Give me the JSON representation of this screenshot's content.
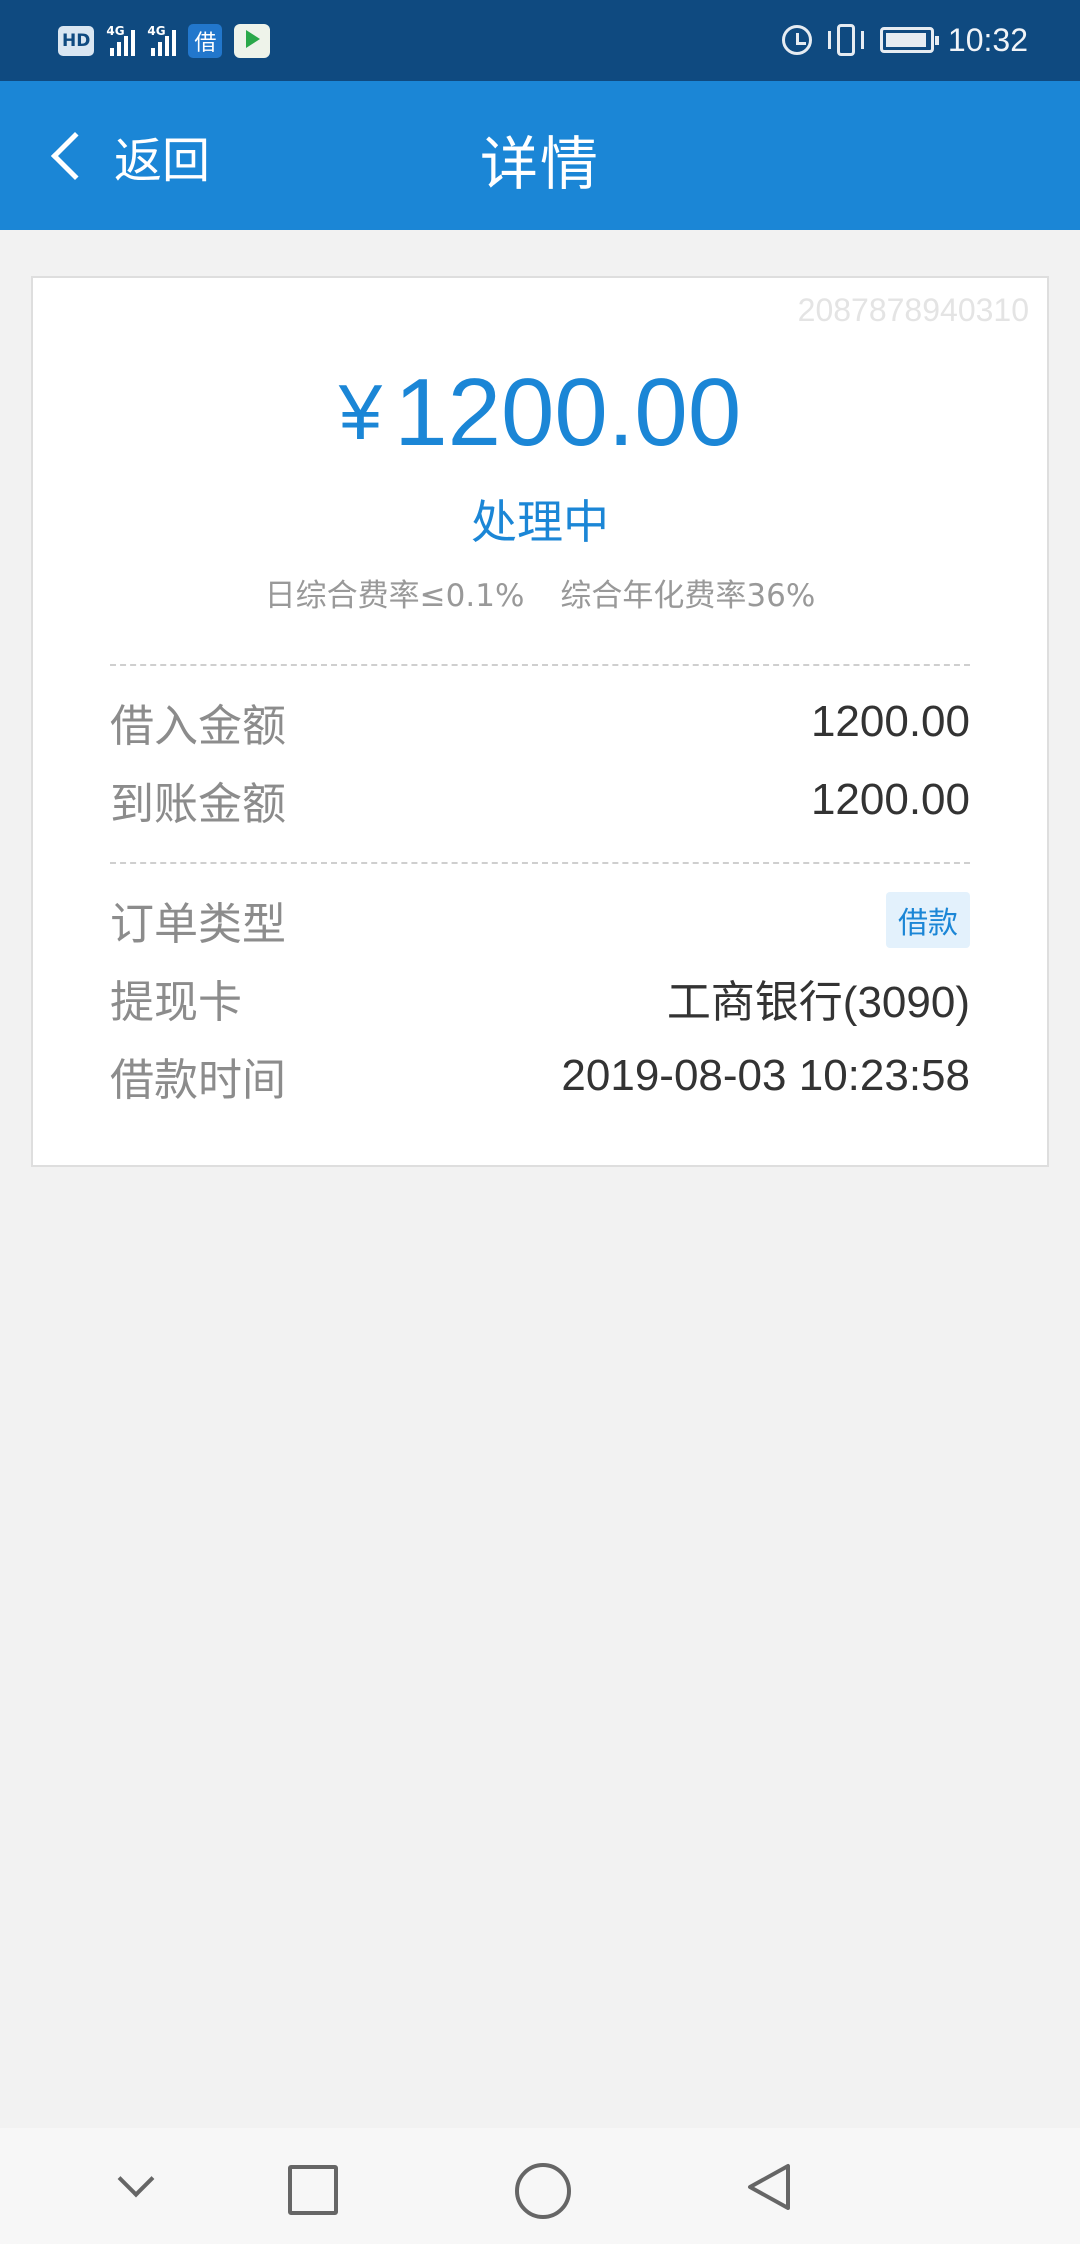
{
  "status_bar": {
    "hd": "HD",
    "sig1_tag": "4G",
    "sig2_tag": "4G",
    "app_badge": "借",
    "time": "10:32",
    "icons": [
      "hd-icon",
      "signal-icon",
      "signal-icon",
      "loan-app-icon",
      "video-app-icon",
      "alarm-icon",
      "vibrate-icon",
      "battery-icon"
    ]
  },
  "header": {
    "back_label": "返回",
    "title": "详情"
  },
  "detail": {
    "order_id": "2087878940310",
    "currency": "¥",
    "amount": "1200.00",
    "status": "处理中",
    "daily_rate": "日综合费率≤0.1%",
    "annual_rate": "综合年化费率36%",
    "rows": [
      {
        "label": "借入金额",
        "value": "1200.00"
      },
      {
        "label": "到账金额",
        "value": "1200.00"
      },
      {
        "label": "订单类型",
        "value": "借款"
      },
      {
        "label": "提现卡",
        "value": "工商银行(3090)"
      },
      {
        "label": "借款时间",
        "value": "2019-08-03 10:23:58"
      }
    ]
  },
  "colors": {
    "status_bar": "#0f4a80",
    "app_bar": "#1b86d6",
    "accent": "#1b86d6",
    "background": "#f2f2f2"
  }
}
